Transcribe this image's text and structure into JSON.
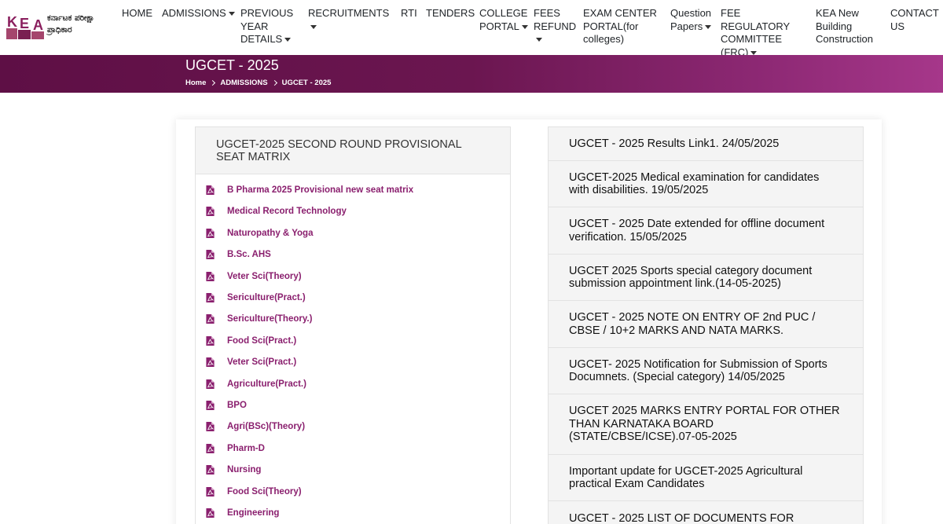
{
  "header": {
    "logo_letters": "KEA",
    "logo_line1": "ಕರ್ನಾಟಕ ಪರೀಕ್ಷಾ",
    "logo_line2": "ಪ್ರಾಧಿಕಾರ",
    "nav": [
      {
        "label": "HOME",
        "dropdown": false
      },
      {
        "label": "ADMISSIONS",
        "dropdown": true
      },
      {
        "label": "PREVIOUS YEAR DETAILS",
        "dropdown": true
      },
      {
        "label": "RECRUITMENTS",
        "dropdown": true
      },
      {
        "label": "RTI",
        "dropdown": false
      },
      {
        "label": "TENDERS",
        "dropdown": false
      },
      {
        "label": "COLLEGE PORTAL",
        "dropdown": true
      },
      {
        "label": "FEES REFUND",
        "dropdown": true
      },
      {
        "label": "EXAM CENTER PORTAL(for colleges)",
        "dropdown": false
      },
      {
        "label": "Question Papers",
        "dropdown": true
      },
      {
        "label": "FEE REGULATORY COMMITTEE (FRC)",
        "dropdown": true
      },
      {
        "label": "KEA New Building Construction",
        "dropdown": false
      },
      {
        "label": "CONTACT US",
        "dropdown": false
      }
    ]
  },
  "banner": {
    "title": "UGCET - 2025",
    "breadcrumbs": [
      "Home",
      "ADMISSIONS",
      "UGCET - 2025"
    ]
  },
  "seat_matrix": {
    "heading": "UGCET-2025 SECOND ROUND PROVISIONAL SEAT MATRIX",
    "items": [
      "B Pharma 2025 Provisional new seat matrix",
      "Medical Record Technology",
      "Naturopathy & Yoga",
      "B.Sc. AHS",
      "Veter Sci(Theory)",
      "Sericulture(Pract.)",
      "Sericulture(Theory.)",
      "Food Sci(Pract.)",
      "Veter Sci(Pract.)",
      "Agriculture(Pract.)",
      "BPO",
      "Agri(BSc)(Theory)",
      "Pharm-D",
      "Nursing",
      "Food Sci(Theory)",
      "Engineering"
    ]
  },
  "notices": [
    "UGCET - 2025 Results Link1. 24/05/2025",
    "UGCET-2025 Medical examination for candidates with disabilities. 19/05/2025",
    "UGCET - 2025 Date extended for offline document verification. 15/05/2025",
    "UGCET 2025 Sports special category document submission appointment link.(14-05-2025)",
    "UGCET - 2025 NOTE ON ENTRY OF 2nd PUC / CBSE / 10+2 MARKS AND NATA MARKS.",
    "UGCET- 2025 Notification for Submission of Sports Documnets. (Special category) 14/05/2025",
    "UGCET 2025 MARKS ENTRY PORTAL FOR OTHER THAN KARNATAKA BOARD (STATE/CBSE/ICSE).07-05-2025",
    "Important update for UGCET-2025 Agricultural practical Exam Candidates",
    "UGCET - 2025 LIST OF DOCUMENTS FOR"
  ],
  "colors": {
    "banner": "#6b1650",
    "link": "#8a1f6e",
    "pdf_icon": "#8a1f6e"
  },
  "icons": {
    "pdf": "file-pdf-icon",
    "caret": "caret-down-icon",
    "breadcrumb_separator": "chevron-right-icon"
  }
}
